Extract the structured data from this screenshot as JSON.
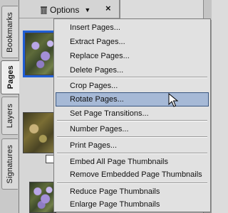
{
  "tabs": [
    {
      "label": "Bookmarks",
      "active": false
    },
    {
      "label": "Pages",
      "active": true
    },
    {
      "label": "Layers",
      "active": false
    },
    {
      "label": "Signatures",
      "active": false
    }
  ],
  "panel": {
    "options_label": "Options",
    "options_arrow": "▼",
    "close_symbol": "×"
  },
  "menu": {
    "items": [
      {
        "label": "Insert Pages..."
      },
      {
        "label": "Extract Pages..."
      },
      {
        "label": "Replace Pages..."
      },
      {
        "label": "Delete Pages..."
      },
      {
        "label": "Crop Pages..."
      },
      {
        "label": "Rotate Pages...",
        "highlighted": true
      },
      {
        "label": "Set Page Transitions..."
      },
      {
        "label": "Number Pages..."
      },
      {
        "label": "Print Pages..."
      },
      {
        "label": "Embed All Page Thumbnails"
      },
      {
        "label": "Remove Embedded Page Thumbnails"
      },
      {
        "label": "Reduce Page Thumbnails"
      },
      {
        "label": "Enlarge Page Thumbnails"
      }
    ]
  },
  "colors": {
    "selection_outline": "#1f5fd6",
    "menu_highlight": "#a6b9d6",
    "menu_background": "#e1e1e1"
  },
  "icons": {
    "panel_icon": "trash-icon",
    "cursor": "arrow-cursor-icon"
  }
}
